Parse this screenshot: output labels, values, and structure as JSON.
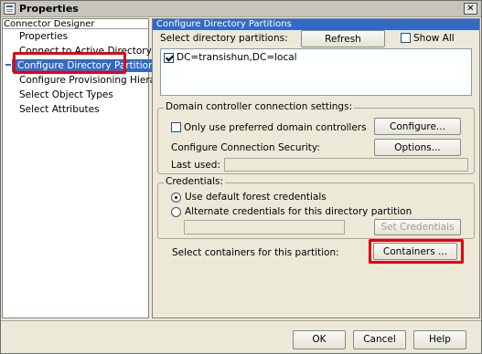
{
  "window": {
    "title": "Properties",
    "close_glyph": "✕"
  },
  "left": {
    "header": "Connector Designer",
    "items": [
      {
        "label": "Properties"
      },
      {
        "label": "Connect to Active Directory Forest"
      },
      {
        "label": "Configure Directory Partitions"
      },
      {
        "label": "Configure Provisioning Hierarchy"
      },
      {
        "label": "Select Object Types"
      },
      {
        "label": "Select Attributes"
      }
    ],
    "selected_index": 2
  },
  "right": {
    "header": "Configure Directory Partitions",
    "select_partitions_label": "Select directory partitions:",
    "refresh_label": "Refresh",
    "show_all_label": "Show All",
    "show_all_checked": false,
    "partitions": [
      {
        "label": "DC=transishun,DC=local",
        "checked": true
      }
    ],
    "dc_group": {
      "title": "Domain controller connection settings:",
      "only_preferred_label": "Only use preferred domain controllers",
      "only_preferred_checked": false,
      "configure_label": "Configure...",
      "security_label": "Configure Connection Security:",
      "options_label": "Options...",
      "last_used_label": "Last used:",
      "last_used_value": ""
    },
    "credentials_group": {
      "title": "Credentials:",
      "default_label": "Use default forest credentials",
      "alternate_label": "Alternate credentials for this directory partition",
      "selected": "default",
      "credentials_value": "",
      "set_credentials_label": "Set Credentials ..."
    },
    "containers_label": "Select containers for this partition:",
    "containers_button": "Containers ..."
  },
  "footer": {
    "ok_label": "OK",
    "cancel_label": "Cancel",
    "help_label": "Help"
  },
  "colors": {
    "selection": "#316ac5",
    "highlight": "#e4000f",
    "window_bg": "#ece9d8"
  }
}
